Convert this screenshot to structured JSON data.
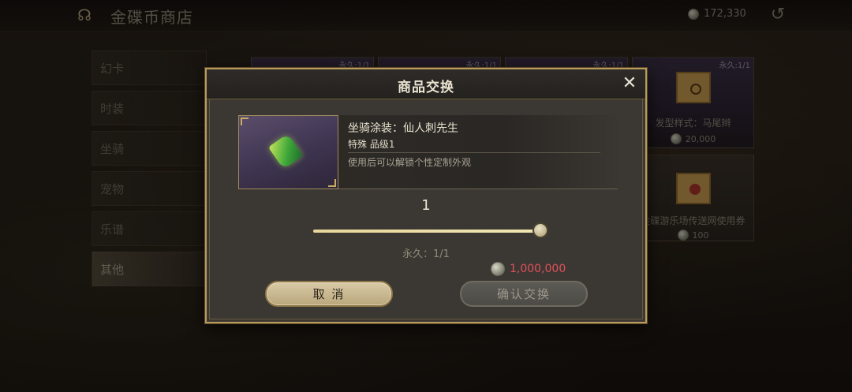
{
  "shop": {
    "title": "金碟币商店",
    "balance": "172,330"
  },
  "menu": {
    "items": [
      {
        "label": "幻卡"
      },
      {
        "label": "时装"
      },
      {
        "label": "坐骑"
      },
      {
        "label": "宠物"
      },
      {
        "label": "乐谱"
      },
      {
        "label": "其他"
      }
    ],
    "active": "其他"
  },
  "background_cards": [
    {
      "tag": "永久:1/1",
      "name": "",
      "price": ""
    },
    {
      "tag": "永久:1/1",
      "name": "",
      "price": ""
    },
    {
      "tag": "永久:1/1",
      "name": "",
      "price": ""
    },
    {
      "tag": "永久:1/1",
      "name": "发型样式：马尾辫",
      "price": "20,000"
    },
    {
      "tag": "",
      "name": "金碟游乐场传送网使用券",
      "price": "100"
    }
  ],
  "dialog": {
    "title": "商品交换",
    "item": {
      "name": "坐骑涂装：仙人刺先生",
      "grade": "特殊  品级1",
      "description": "使用后可以解锁个性定制外观"
    },
    "quantity": "1",
    "slider_fraction": 1.0,
    "limit": "永久：1/1",
    "cost": "1,000,000",
    "cost_color": "#e0505a",
    "cancel_label": "取 消",
    "confirm_label": "确认交换"
  },
  "icons": [
    "shop-logo-icon",
    "coin-icon",
    "back-arrow-icon",
    "close-icon",
    "cactus-item-icon"
  ]
}
